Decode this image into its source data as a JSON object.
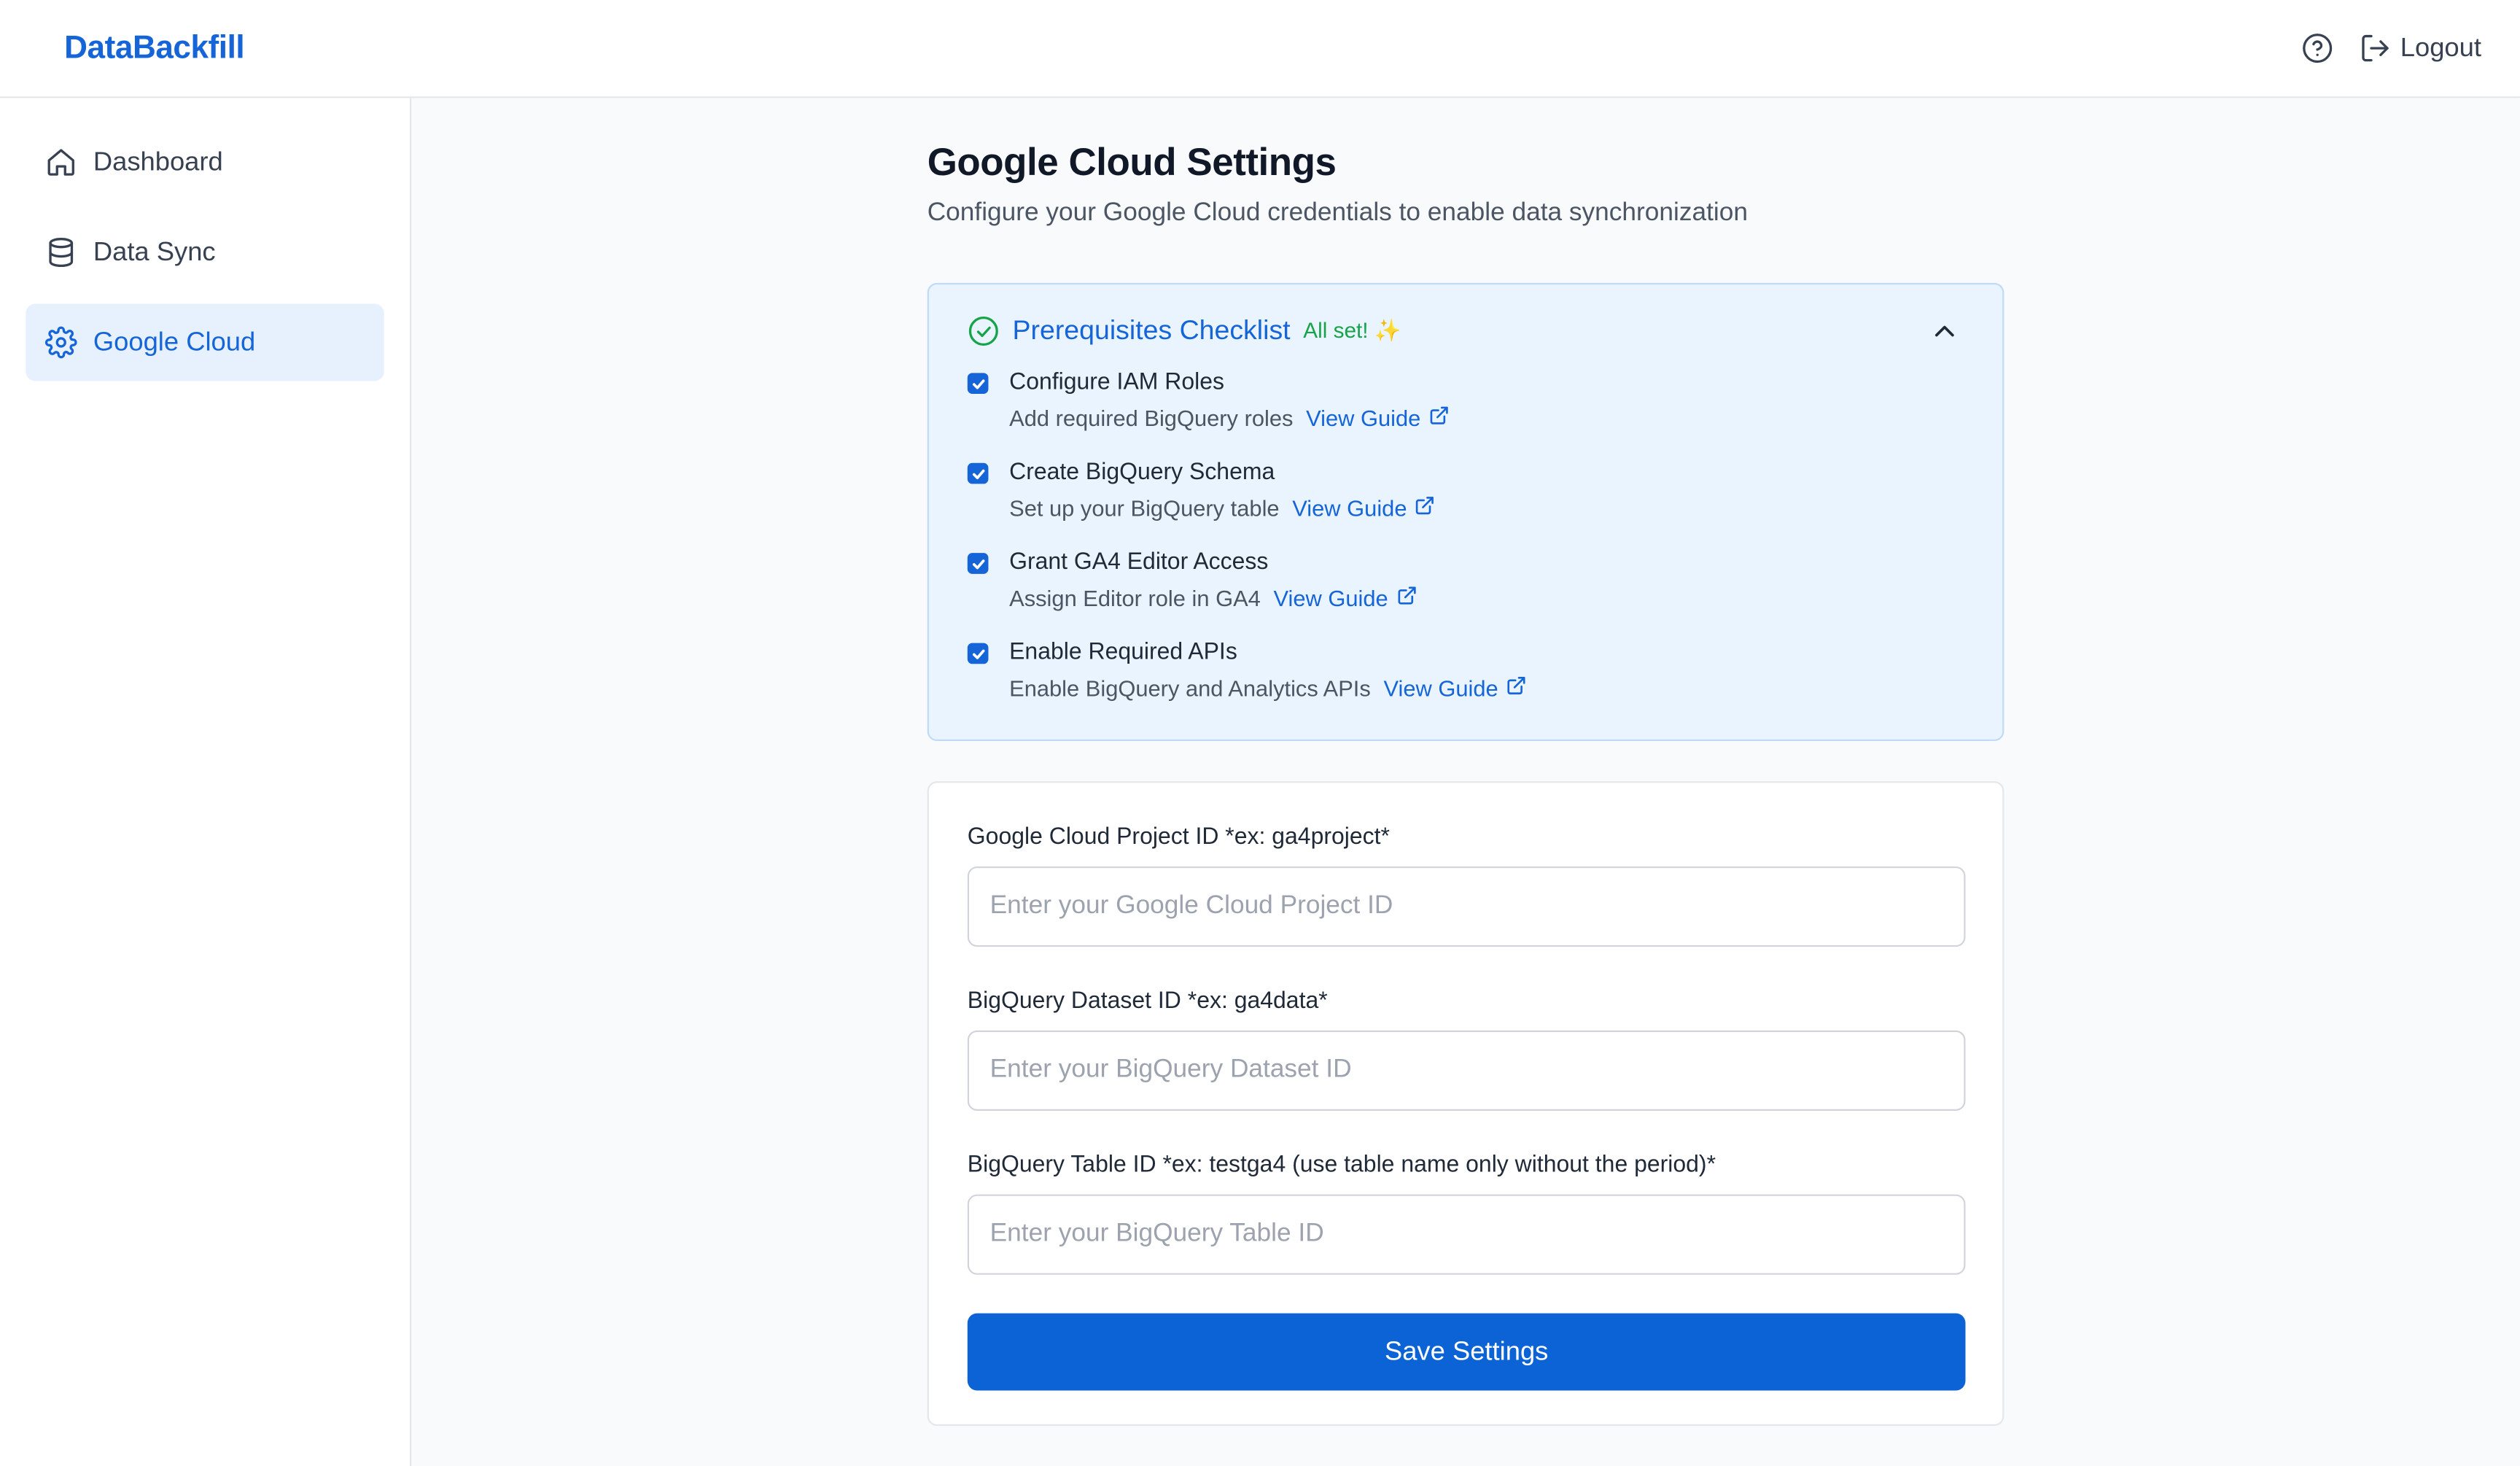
{
  "header": {
    "brand": "DataBackfill",
    "logout_label": "Logout"
  },
  "sidebar": {
    "items": [
      {
        "label": "Dashboard",
        "icon": "home-icon"
      },
      {
        "label": "Data Sync",
        "icon": "database-icon"
      },
      {
        "label": "Google Cloud",
        "icon": "gear-icon",
        "active": true
      }
    ]
  },
  "page": {
    "title": "Google Cloud Settings",
    "subtitle": "Configure your Google Cloud credentials to enable data synchronization"
  },
  "checklist": {
    "title": "Prerequisites Checklist",
    "badge": "All set! ✨",
    "items": [
      {
        "title": "Configure IAM Roles",
        "desc": "Add required BigQuery roles",
        "link": "View Guide",
        "checked": true
      },
      {
        "title": "Create BigQuery Schema",
        "desc": "Set up your BigQuery table",
        "link": "View Guide",
        "checked": true
      },
      {
        "title": "Grant GA4 Editor Access",
        "desc": "Assign Editor role in GA4",
        "link": "View Guide",
        "checked": true
      },
      {
        "title": "Enable Required APIs",
        "desc": "Enable BigQuery and Analytics APIs",
        "link": "View Guide",
        "checked": true
      }
    ]
  },
  "form": {
    "project": {
      "label": "Google Cloud Project ID *ex: ga4project*",
      "placeholder": "Enter your Google Cloud Project ID",
      "value": ""
    },
    "dataset": {
      "label": "BigQuery Dataset ID *ex: ga4data*",
      "placeholder": "Enter your BigQuery Dataset ID",
      "value": ""
    },
    "table": {
      "label": "BigQuery Table ID *ex: testga4 (use table name only without the period)*",
      "placeholder": "Enter your BigQuery Table ID",
      "value": ""
    },
    "save_label": "Save Settings"
  },
  "colors": {
    "accent": "#1565d8",
    "success": "#16a34a",
    "checklist_bg": "#eaf4fe",
    "button": "#0b63d6"
  }
}
